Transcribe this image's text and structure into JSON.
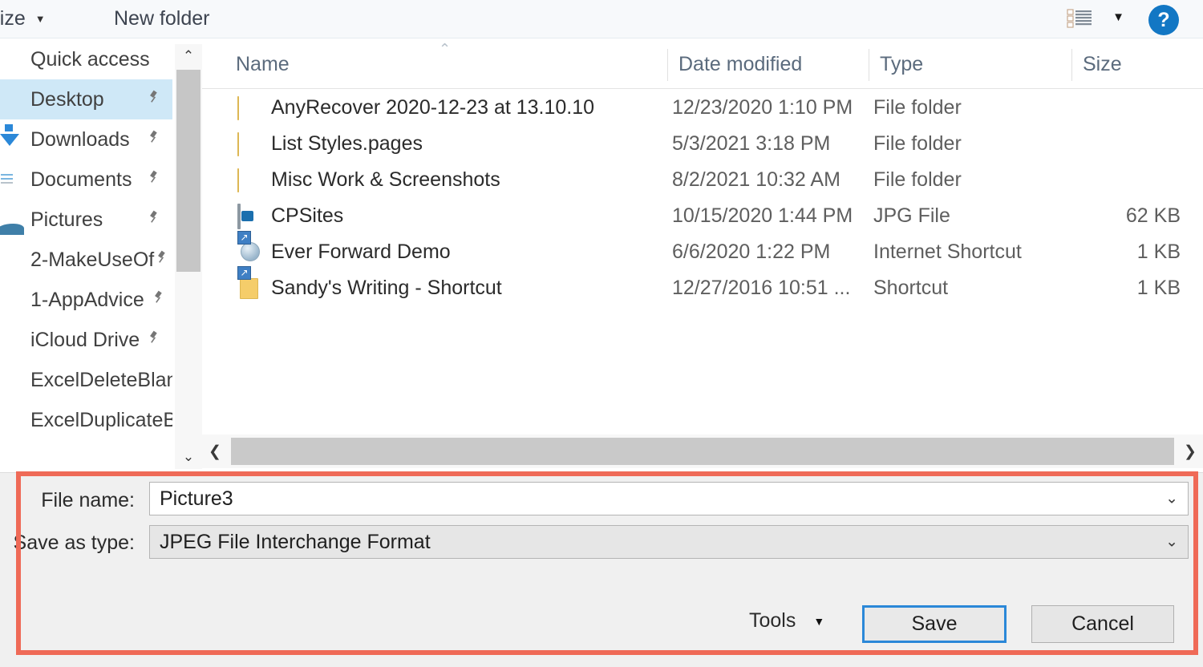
{
  "window": {
    "kind": "save-as-dialog",
    "accent_blue": "#2b88d8",
    "annotation_color": "#ef6a57",
    "selection_color": "#cfe8f7"
  },
  "toolbar": {
    "organize_label": "anize",
    "organize_caret": "▼",
    "new_folder_label": "New folder",
    "view_icon": "list-view-icon",
    "view_caret": "▼",
    "help_label": "?"
  },
  "sidebar": {
    "items": [
      {
        "label": "Quick access",
        "icon": "chevron-right-icon",
        "pinned": false,
        "selected": false
      },
      {
        "label": "Desktop",
        "icon": "monitor-icon",
        "pinned": true,
        "selected": true
      },
      {
        "label": "Downloads",
        "icon": "download-arrow-icon",
        "pinned": true,
        "selected": false
      },
      {
        "label": "Documents",
        "icon": "document-icon",
        "pinned": true,
        "selected": false
      },
      {
        "label": "Pictures",
        "icon": "picture-icon",
        "pinned": true,
        "selected": false
      },
      {
        "label": "2-MakeUseOf",
        "icon": "folder-icon",
        "pinned": true,
        "selected": false
      },
      {
        "label": "1-AppAdvice",
        "icon": "folder-icon",
        "pinned": true,
        "selected": false
      },
      {
        "label": "iCloud Drive",
        "icon": "folder-icon",
        "pinned": true,
        "selected": false
      },
      {
        "label": "ExcelDeleteBlanl",
        "icon": "folder-icon",
        "pinned": false,
        "selected": false
      },
      {
        "label": "ExcelDuplicateBl",
        "icon": "folder-icon",
        "pinned": false,
        "selected": false
      }
    ],
    "pin_glyph": "📌"
  },
  "scrollbars": {
    "vertical": {
      "up_glyph": "⌃",
      "down_glyph": "⌄"
    },
    "horizontal": {
      "left_glyph": "❮",
      "right_glyph": "❯"
    }
  },
  "file_list": {
    "sort_caret": "⌃",
    "columns": [
      {
        "label": "Name"
      },
      {
        "label": "Date modified"
      },
      {
        "label": "Type"
      },
      {
        "label": "Size"
      }
    ],
    "rows": [
      {
        "name": "AnyRecover 2020-12-23 at 13.10.10",
        "date": "12/23/2020 1:10 PM",
        "type": "File folder",
        "size": "",
        "icon": "folder-icon"
      },
      {
        "name": "List Styles.pages",
        "date": "5/3/2021 3:18 PM",
        "type": "File folder",
        "size": "",
        "icon": "folder-icon"
      },
      {
        "name": "Misc Work & Screenshots",
        "date": "8/2/2021 10:32 AM",
        "type": "File folder",
        "size": "",
        "icon": "folder-icon"
      },
      {
        "name": "CPSites",
        "date": "10/15/2020 1:44 PM",
        "type": "JPG File",
        "size": "62 KB",
        "icon": "jpg-file-icon"
      },
      {
        "name": "Ever Forward Demo",
        "date": "6/6/2020 1:22 PM",
        "type": "Internet Shortcut",
        "size": "1 KB",
        "icon": "internet-shortcut-icon"
      },
      {
        "name": "Sandy's Writing - Shortcut",
        "date": "12/27/2016 10:51 ...",
        "type": "Shortcut",
        "size": "1 KB",
        "icon": "folder-shortcut-icon"
      }
    ]
  },
  "form": {
    "file_name_label": "File name:",
    "file_name_value": "Picture3",
    "save_as_type_label": "Save as type:",
    "save_as_type_value": "JPEG File Interchange Format",
    "dropdown_caret": "⌄"
  },
  "actions": {
    "tools_label": "Tools",
    "tools_caret": "▼",
    "save_label": "Save",
    "cancel_label": "Cancel"
  }
}
